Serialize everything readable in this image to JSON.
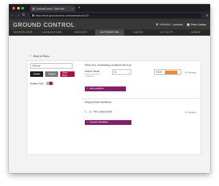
{
  "browser": {
    "tab_title": "GroundControl - Edit Rule",
    "url": "https://excel.groundcontrol.com/automation/1128"
  },
  "app": {
    "logo": "GROUND CONTROL",
    "version_label": "VIEWING - Australia",
    "user_label": "Peter Lindley"
  },
  "nav": {
    "workflows": "WORKFLOWS",
    "launchcode": "LAUNCHCODE",
    "devices": "DEVICES",
    "automation": "AUTOMATION",
    "cache": "CACHE",
    "activity": "ACTIVITY",
    "admin": "ADMIN"
  },
  "page": {
    "back_label": "Back to Rules",
    "rule_name": "Clinical",
    "delete_label": "Delete",
    "cancel_label": "Cancel",
    "save_label": "Save Rule",
    "enable_label": "Enable Rule",
    "enable_on": true
  },
  "conditions": {
    "title": "When ALL of following conditions are true",
    "field_label": "Device Serial",
    "field_hint": "Learn a rule to fit conditions...",
    "operator": "is",
    "value_prefix": "DL00",
    "remove_label": "Remove",
    "add_label": "Add condition"
  },
  "workflows": {
    "title": "Deploy these workflows",
    "item_number": "1.",
    "item_id": "28",
    "item_name": "PHL Clinical OEF",
    "remove_label": "Remove",
    "choose_label": "Choose Workflow..."
  },
  "colors": {
    "accent": "#a8133f",
    "purple": "#871c6c",
    "header": "#383838"
  }
}
